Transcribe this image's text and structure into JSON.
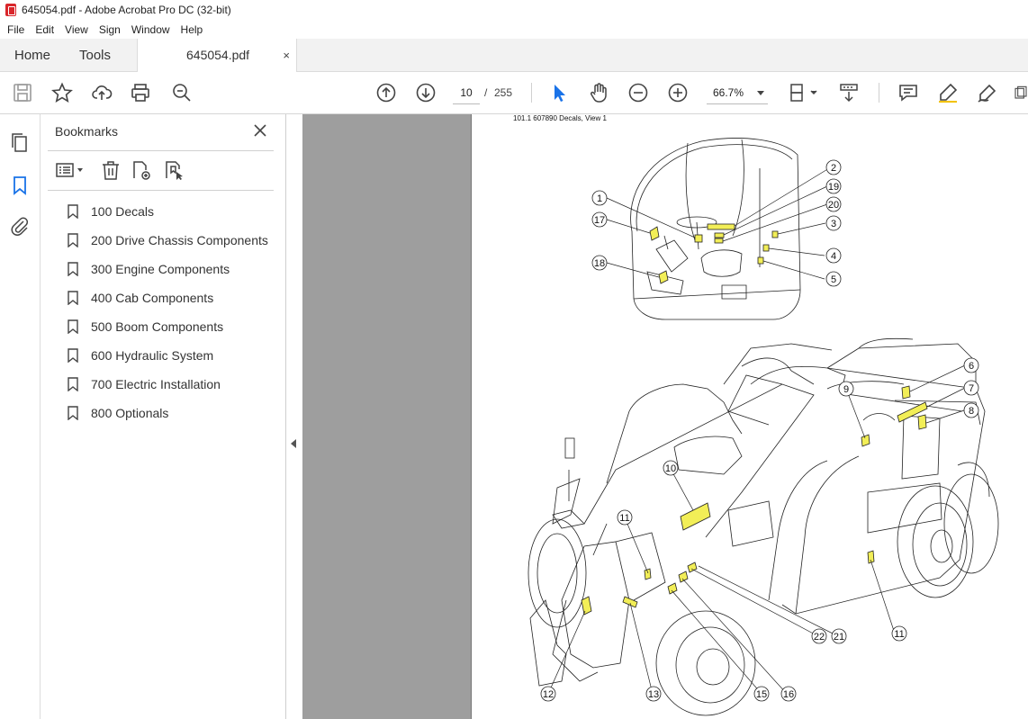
{
  "window": {
    "title": "645054.pdf - Adobe Acrobat Pro DC (32-bit)"
  },
  "menu": [
    "File",
    "Edit",
    "View",
    "Sign",
    "Window",
    "Help"
  ],
  "tabs": {
    "home": "Home",
    "tools": "Tools",
    "document": "645054.pdf",
    "close": "×"
  },
  "toolbar": {
    "page_current": "10",
    "page_separator": "/",
    "page_total": "255",
    "zoom": "66.7%"
  },
  "bookmarks": {
    "title": "Bookmarks",
    "items": [
      {
        "label": "100 Decals"
      },
      {
        "label": "200 Drive Chassis Components"
      },
      {
        "label": "300 Engine Components"
      },
      {
        "label": "400 Cab Components"
      },
      {
        "label": "500 Boom Components"
      },
      {
        "label": "600 Hydraulic System"
      },
      {
        "label": "700 Electric Installation"
      },
      {
        "label": "800 Optionals"
      }
    ]
  },
  "page": {
    "header": "101.1 607890 Decals, View 1",
    "callouts": [
      "1",
      "2",
      "3",
      "4",
      "5",
      "6",
      "7",
      "8",
      "9",
      "10",
      "11",
      "11",
      "12",
      "13",
      "15",
      "16",
      "17",
      "18",
      "19",
      "20",
      "21",
      "22"
    ]
  },
  "colors": {
    "decal": "#f2ee57",
    "viewer_bg": "#9e9e9e",
    "pdf_red": "#d9262b"
  }
}
